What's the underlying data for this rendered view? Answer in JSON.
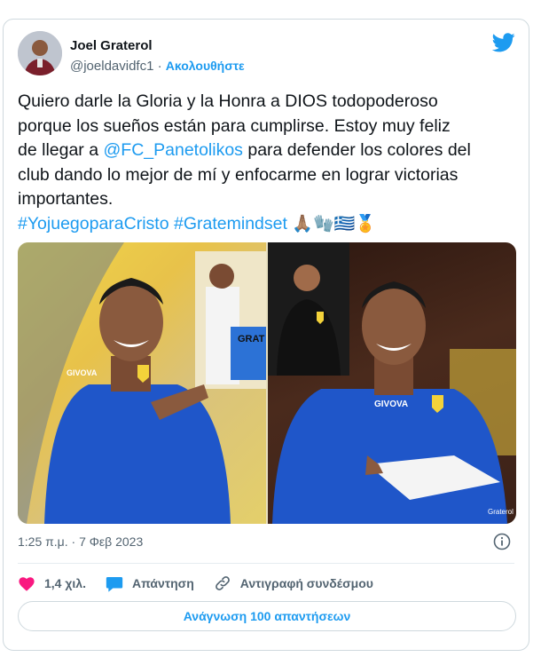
{
  "author": {
    "name": "Joel Graterol",
    "handle": "@joeldavidfc1",
    "separator": "·",
    "follow_label": "Ακολουθήστε"
  },
  "tweet": {
    "text_part1": "Quiero darle la Gloria y la Honra a DIOS todopoderoso\nporque los sueños están para cumplirse. Estoy muy feliz\nde llegar a ",
    "mention": "@FC_Panetolikos",
    "text_part2": " para defender los colores del\nclub dando lo mejor de mí y enfocarme en lograr victorias\nimportantes.\n",
    "hashtag1": "#YojuegoparaCristo",
    "hashtag2": "#Gratemindset",
    "emojis": "🙏🏽🧤🇬🇷🏅"
  },
  "media": {
    "left_brand": "GIVOVA",
    "right_brand": "GIVOVA",
    "jersey_text": "GRAT",
    "watermark": "Graterol"
  },
  "timestamp": "1:25 π.μ. · 7 Φεβ 2023",
  "actions": {
    "like_count": "1,4 χιλ.",
    "reply_label": "Απάντηση",
    "copy_link_label": "Αντιγραφή συνδέσμου"
  },
  "read_replies_label": "Ανάγνωση 100 απαντήσεων",
  "colors": {
    "accent": "#1d9bf0",
    "like": "#f91880",
    "text": "#0f1419",
    "muted": "#536471"
  }
}
